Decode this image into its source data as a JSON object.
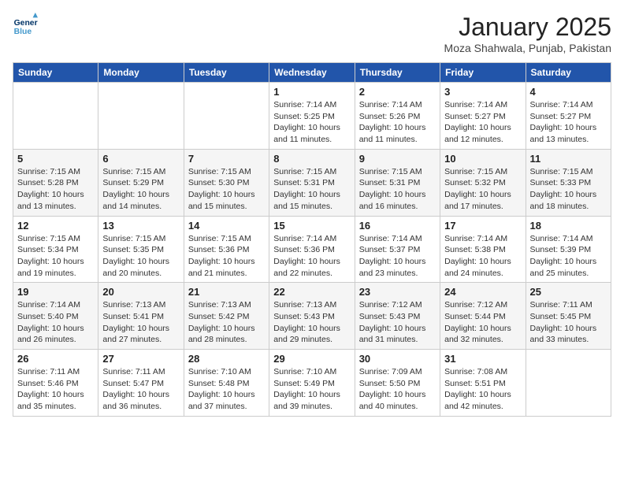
{
  "header": {
    "logo_line1": "General",
    "logo_line2": "Blue",
    "month_title": "January 2025",
    "subtitle": "Moza Shahwala, Punjab, Pakistan"
  },
  "columns": [
    "Sunday",
    "Monday",
    "Tuesday",
    "Wednesday",
    "Thursday",
    "Friday",
    "Saturday"
  ],
  "weeks": [
    [
      {
        "day": "",
        "info": ""
      },
      {
        "day": "",
        "info": ""
      },
      {
        "day": "",
        "info": ""
      },
      {
        "day": "1",
        "info": "Sunrise: 7:14 AM\nSunset: 5:25 PM\nDaylight: 10 hours and 11 minutes."
      },
      {
        "day": "2",
        "info": "Sunrise: 7:14 AM\nSunset: 5:26 PM\nDaylight: 10 hours and 11 minutes."
      },
      {
        "day": "3",
        "info": "Sunrise: 7:14 AM\nSunset: 5:27 PM\nDaylight: 10 hours and 12 minutes."
      },
      {
        "day": "4",
        "info": "Sunrise: 7:14 AM\nSunset: 5:27 PM\nDaylight: 10 hours and 13 minutes."
      }
    ],
    [
      {
        "day": "5",
        "info": "Sunrise: 7:15 AM\nSunset: 5:28 PM\nDaylight: 10 hours and 13 minutes."
      },
      {
        "day": "6",
        "info": "Sunrise: 7:15 AM\nSunset: 5:29 PM\nDaylight: 10 hours and 14 minutes."
      },
      {
        "day": "7",
        "info": "Sunrise: 7:15 AM\nSunset: 5:30 PM\nDaylight: 10 hours and 15 minutes."
      },
      {
        "day": "8",
        "info": "Sunrise: 7:15 AM\nSunset: 5:31 PM\nDaylight: 10 hours and 15 minutes."
      },
      {
        "day": "9",
        "info": "Sunrise: 7:15 AM\nSunset: 5:31 PM\nDaylight: 10 hours and 16 minutes."
      },
      {
        "day": "10",
        "info": "Sunrise: 7:15 AM\nSunset: 5:32 PM\nDaylight: 10 hours and 17 minutes."
      },
      {
        "day": "11",
        "info": "Sunrise: 7:15 AM\nSunset: 5:33 PM\nDaylight: 10 hours and 18 minutes."
      }
    ],
    [
      {
        "day": "12",
        "info": "Sunrise: 7:15 AM\nSunset: 5:34 PM\nDaylight: 10 hours and 19 minutes."
      },
      {
        "day": "13",
        "info": "Sunrise: 7:15 AM\nSunset: 5:35 PM\nDaylight: 10 hours and 20 minutes."
      },
      {
        "day": "14",
        "info": "Sunrise: 7:15 AM\nSunset: 5:36 PM\nDaylight: 10 hours and 21 minutes."
      },
      {
        "day": "15",
        "info": "Sunrise: 7:14 AM\nSunset: 5:36 PM\nDaylight: 10 hours and 22 minutes."
      },
      {
        "day": "16",
        "info": "Sunrise: 7:14 AM\nSunset: 5:37 PM\nDaylight: 10 hours and 23 minutes."
      },
      {
        "day": "17",
        "info": "Sunrise: 7:14 AM\nSunset: 5:38 PM\nDaylight: 10 hours and 24 minutes."
      },
      {
        "day": "18",
        "info": "Sunrise: 7:14 AM\nSunset: 5:39 PM\nDaylight: 10 hours and 25 minutes."
      }
    ],
    [
      {
        "day": "19",
        "info": "Sunrise: 7:14 AM\nSunset: 5:40 PM\nDaylight: 10 hours and 26 minutes."
      },
      {
        "day": "20",
        "info": "Sunrise: 7:13 AM\nSunset: 5:41 PM\nDaylight: 10 hours and 27 minutes."
      },
      {
        "day": "21",
        "info": "Sunrise: 7:13 AM\nSunset: 5:42 PM\nDaylight: 10 hours and 28 minutes."
      },
      {
        "day": "22",
        "info": "Sunrise: 7:13 AM\nSunset: 5:43 PM\nDaylight: 10 hours and 29 minutes."
      },
      {
        "day": "23",
        "info": "Sunrise: 7:12 AM\nSunset: 5:43 PM\nDaylight: 10 hours and 31 minutes."
      },
      {
        "day": "24",
        "info": "Sunrise: 7:12 AM\nSunset: 5:44 PM\nDaylight: 10 hours and 32 minutes."
      },
      {
        "day": "25",
        "info": "Sunrise: 7:11 AM\nSunset: 5:45 PM\nDaylight: 10 hours and 33 minutes."
      }
    ],
    [
      {
        "day": "26",
        "info": "Sunrise: 7:11 AM\nSunset: 5:46 PM\nDaylight: 10 hours and 35 minutes."
      },
      {
        "day": "27",
        "info": "Sunrise: 7:11 AM\nSunset: 5:47 PM\nDaylight: 10 hours and 36 minutes."
      },
      {
        "day": "28",
        "info": "Sunrise: 7:10 AM\nSunset: 5:48 PM\nDaylight: 10 hours and 37 minutes."
      },
      {
        "day": "29",
        "info": "Sunrise: 7:10 AM\nSunset: 5:49 PM\nDaylight: 10 hours and 39 minutes."
      },
      {
        "day": "30",
        "info": "Sunrise: 7:09 AM\nSunset: 5:50 PM\nDaylight: 10 hours and 40 minutes."
      },
      {
        "day": "31",
        "info": "Sunrise: 7:08 AM\nSunset: 5:51 PM\nDaylight: 10 hours and 42 minutes."
      },
      {
        "day": "",
        "info": ""
      }
    ]
  ]
}
